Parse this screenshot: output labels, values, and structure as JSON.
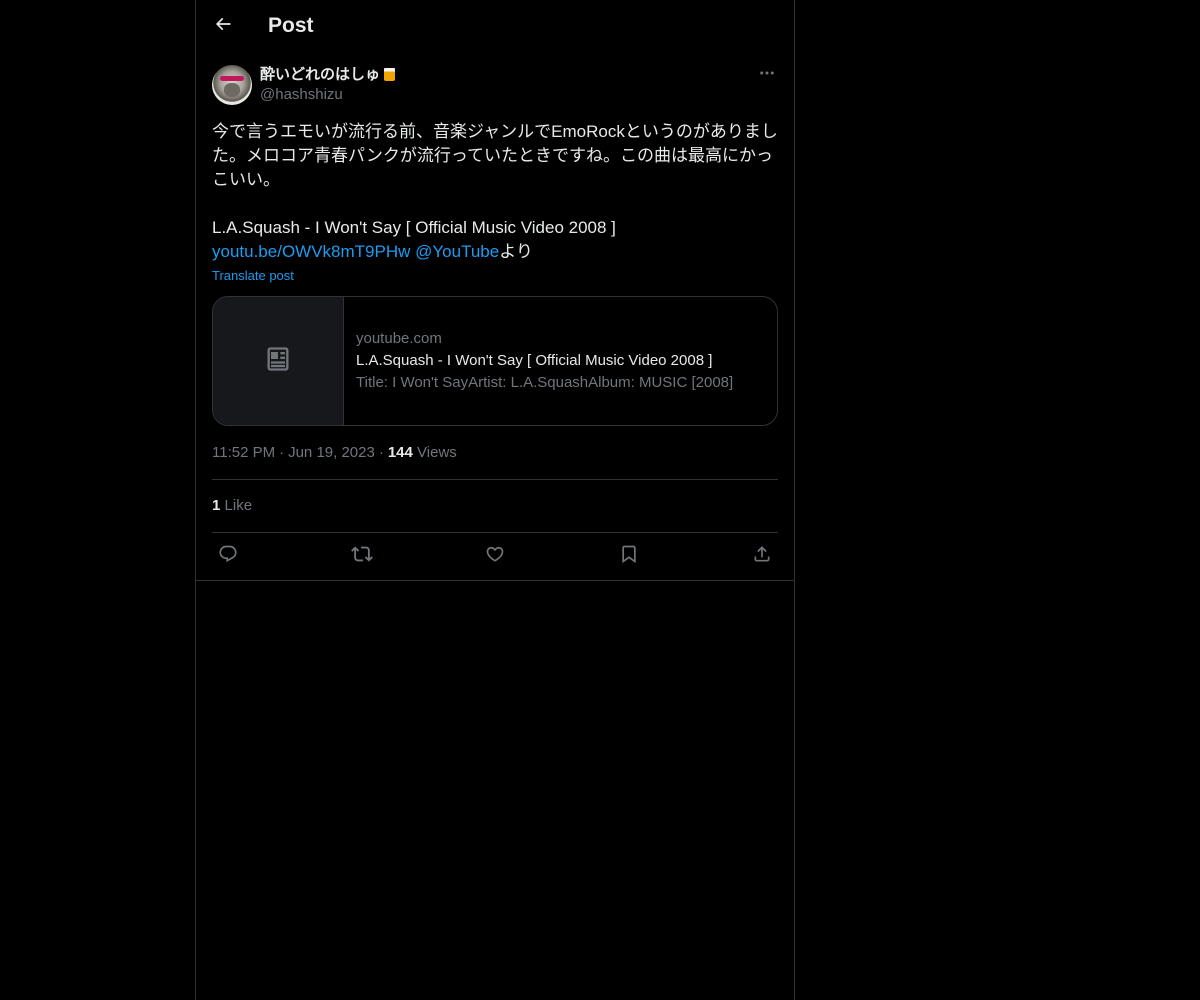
{
  "header": {
    "title": "Post",
    "back_icon": "arrow-left-icon"
  },
  "post": {
    "author": {
      "display_name": "酔いどれのはしゅ",
      "emoji_icon": "beer-mug-icon",
      "handle": "@hashshizu"
    },
    "text_main": "今で言うエモいが流行る前、音楽ジャンルでEmoRockというのがありました。メロコア青春パンクが流行っていたときですね。この曲は最高にかっこいい。\n\nL.A.Squash - I Won't Say [ Official Music Video 2008 ]\n",
    "link_url": "youtu.be/OWVk8mT9PHw",
    "mention": "@YouTube",
    "text_suffix": "より",
    "translate_label": "Translate post",
    "card": {
      "domain": "youtube.com",
      "title": "L.A.Squash - I Won't Say [ Official Music Video 2008 ]",
      "description": "Title: I Won't SayArtist: L.A.SquashAlbum: MUSIC [2008]",
      "thumb_icon": "article-icon"
    },
    "time": "11:52 PM",
    "date": "Jun 19, 2023",
    "views_count": "144",
    "views_label": "Views",
    "likes_count": "1",
    "likes_label": "Like"
  },
  "actions": {
    "reply_icon": "reply-icon",
    "repost_icon": "repost-icon",
    "like_icon": "heart-icon",
    "bookmark_icon": "bookmark-icon",
    "share_icon": "share-icon"
  },
  "colors": {
    "background": "#000000",
    "text": "#e7e9ea",
    "secondary": "#71767b",
    "accent": "#1d9bf0",
    "border": "#2f3336"
  }
}
